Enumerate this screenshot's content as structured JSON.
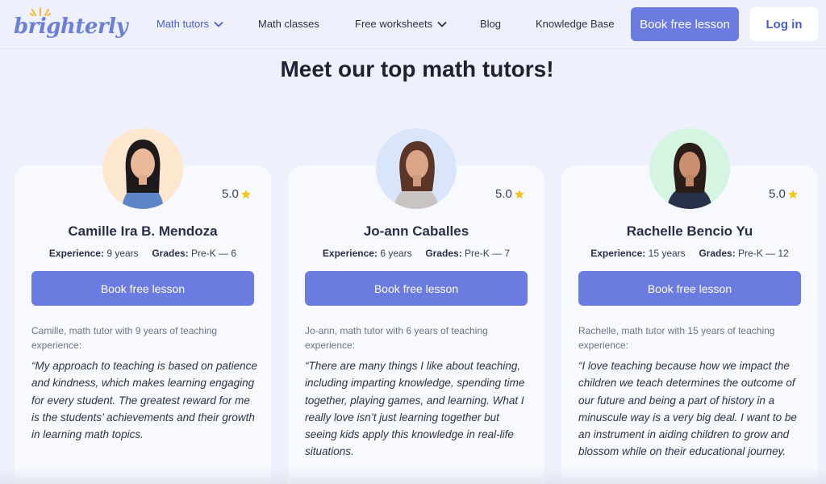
{
  "brand": {
    "logo_text": "brighterly"
  },
  "nav": {
    "items": [
      {
        "label": "Math tutors",
        "has_dropdown": true,
        "active": true
      },
      {
        "label": "Math classes",
        "has_dropdown": false,
        "active": false
      },
      {
        "label": "Free worksheets",
        "has_dropdown": true,
        "active": false
      },
      {
        "label": "Blog",
        "has_dropdown": false,
        "active": false
      },
      {
        "label": "Knowledge Base",
        "has_dropdown": false,
        "active": false
      }
    ],
    "book_button": "Book free lesson",
    "login_button": "Log in"
  },
  "page_title": "Meet our top math tutors!",
  "colors": {
    "accent": "#6b7be0",
    "background": "#eef1fb",
    "star": "#f5c518"
  },
  "tutors": [
    {
      "name": "Camille Ira B. Mendoza",
      "rating": "5.0",
      "experience_label": "Experience:",
      "experience": "9 years",
      "grades_label": "Grades:",
      "grades": "Pre-K — 6",
      "button": "Book free lesson",
      "intro": "Camille, math tutor with 9 years of teaching experience:",
      "quote": "“My approach to teaching is based on patience and kindness, which makes learning engaging for every student. The greatest reward for me is the students’ achievements and their growth in learning math topics.",
      "avatar_bg": "#fde7cf"
    },
    {
      "name": "Jo-ann Caballes",
      "rating": "5.0",
      "experience_label": "Experience:",
      "experience": "6 years",
      "grades_label": "Grades:",
      "grades": "Pre-K — 7",
      "button": "Book free lesson",
      "intro": "Jo-ann, math tutor with 6 years of teaching experience:",
      "quote": "“There are many things I like about teaching, including imparting knowledge, spending time together, playing games, and learning. What I really love isn’t just learning together but seeing kids apply this knowledge in real-life situations.",
      "avatar_bg": "#d9e5fb"
    },
    {
      "name": "Rachelle Bencio Yu",
      "rating": "5.0",
      "experience_label": "Experience:",
      "experience": "15 years",
      "grades_label": "Grades:",
      "grades": "Pre-K — 12",
      "button": "Book free lesson",
      "intro": "Rachelle, math tutor with 15 years of teaching experience:",
      "quote": "“I love teaching because how we impact the children we teach determines the outcome of our future and being a part of history in a minuscule way is a very big deal. I want to be an instrument in aiding children to grow and blossom while on their educational journey.",
      "avatar_bg": "#d4f5e2"
    }
  ]
}
